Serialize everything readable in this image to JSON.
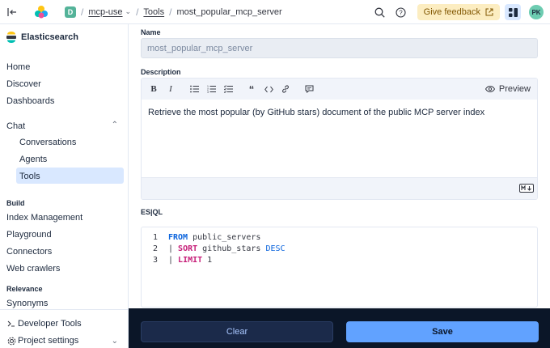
{
  "topbar": {
    "space_initial": "D",
    "breadcrumb_project": "mcp-use",
    "breadcrumb_tools": "Tools",
    "breadcrumb_current": "most_popular_mcp_server",
    "feedback_label": "Give feedback",
    "avatar_initials": "PK"
  },
  "sidebar": {
    "title": "Elasticsearch",
    "items": {
      "home": "Home",
      "discover": "Discover",
      "dashboards": "Dashboards",
      "chat": "Chat",
      "conversations": "Conversations",
      "agents": "Agents",
      "tools": "Tools"
    },
    "sections": {
      "build": "Build",
      "relevance": "Relevance"
    },
    "build_items": {
      "index_management": "Index Management",
      "playground": "Playground",
      "connectors": "Connectors",
      "web_crawlers": "Web crawlers"
    },
    "relevance_items": {
      "synonyms": "Synonyms"
    },
    "footer": {
      "developer_tools": "Developer Tools",
      "project_settings": "Project settings"
    }
  },
  "form": {
    "name_label": "Name",
    "name_value": "most_popular_mcp_server",
    "description_label": "Description",
    "preview_label": "Preview",
    "description_value": "Retrieve the most popular (by GitHub stars) document of the public MCP server index",
    "esql_label": "ES|QL",
    "code": {
      "l1_num": "1",
      "l1_kw": "FROM",
      "l1_rest": " public_servers",
      "l2_num": "2",
      "l2_pipe": "| ",
      "l2_kw": "SORT",
      "l2_mid": " github_stars ",
      "l2_kw2": "DESC",
      "l3_num": "3",
      "l3_pipe": "| ",
      "l3_kw": "LIMIT",
      "l3_rest": " 1"
    }
  },
  "actions": {
    "clear_label": "Clear",
    "save_label": "Save"
  },
  "colors": {
    "accent": "#61a2ff",
    "feedback_bg": "#fcedc1",
    "bottom_bar": "#0b1628",
    "active_nav": "#d9e8ff"
  }
}
